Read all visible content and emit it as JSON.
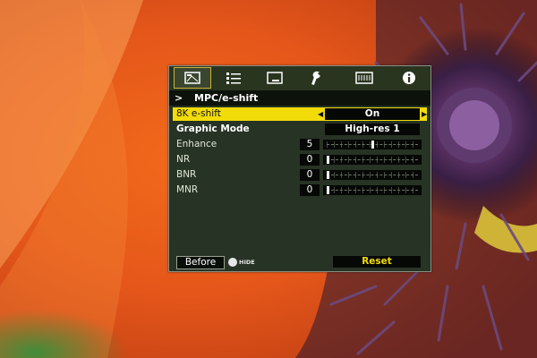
{
  "tabs": [
    {
      "icon": "picture-adjust-icon",
      "active": true
    },
    {
      "icon": "input-settings-icon",
      "active": false
    },
    {
      "icon": "installation-icon",
      "active": false
    },
    {
      "icon": "function-wrench-icon",
      "active": false
    },
    {
      "icon": "display-setup-icon",
      "active": false
    },
    {
      "icon": "information-icon",
      "active": false
    }
  ],
  "menu": {
    "chevron": ">",
    "title": "MPC/e-shift"
  },
  "rows": {
    "e_shift": {
      "label": "8K e-shift",
      "value": "On",
      "left_arrow": "◀",
      "right_arrow": "▶"
    },
    "graphic_mode": {
      "label": "Graphic Mode",
      "value": "High-res 1"
    },
    "enhance": {
      "label": "Enhance",
      "value": "5",
      "level": 5,
      "range": [
        0,
        10
      ]
    },
    "nr": {
      "label": "NR",
      "value": "0",
      "level": 0,
      "range": [
        0,
        10
      ]
    },
    "bnr": {
      "label": "BNR",
      "value": "0",
      "level": 0,
      "range": [
        0,
        10
      ]
    },
    "mnr": {
      "label": "MNR",
      "value": "0",
      "level": 0,
      "range": [
        0,
        10
      ]
    }
  },
  "footer": {
    "before_label": "Before",
    "hide_label": "HIDE",
    "reset_label": "Reset"
  },
  "colors": {
    "highlight": "#f1dc0a",
    "panel": "#273324",
    "reset_text": "#f1dc0a"
  }
}
